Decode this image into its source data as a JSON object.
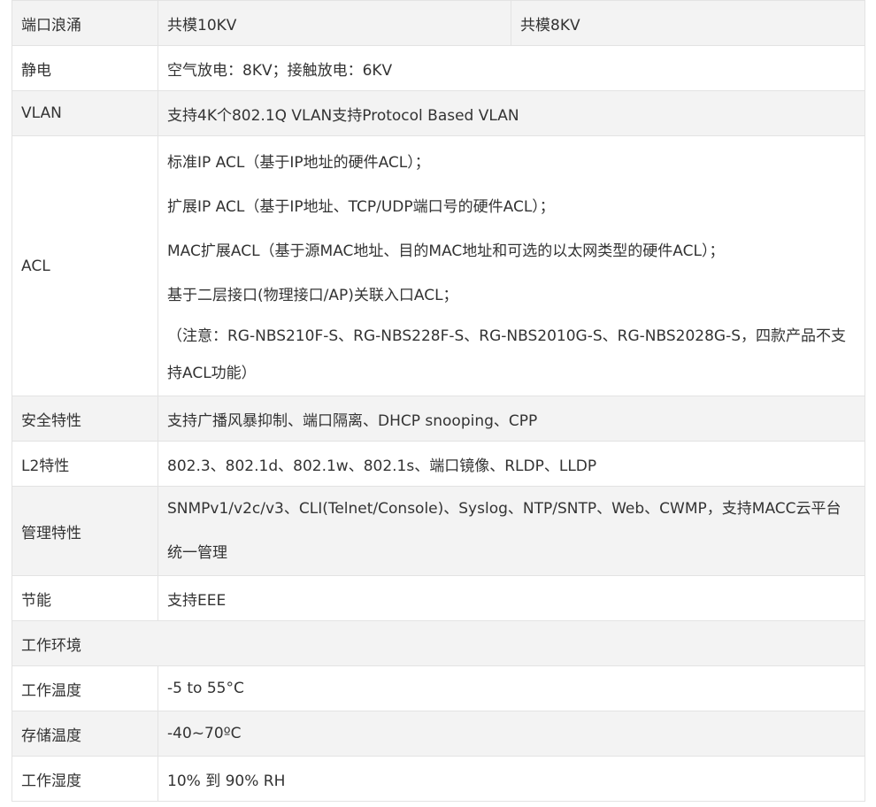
{
  "rows": [
    {
      "label": "端口浪涌",
      "value": "共模10KV",
      "value2": "共模8KV"
    },
    {
      "label": "静电",
      "value": "空气放电：8KV；接触放电：6KV"
    },
    {
      "label": "VLAN",
      "value": "支持4K个802.1Q VLAN支持Protocol Based VLAN"
    },
    {
      "label": "ACL",
      "lines": [
        "标准IP ACL（基于IP地址的硬件ACL）；",
        "扩展IP ACL（基于IP地址、TCP/UDP端口号的硬件ACL）；",
        "MAC扩展ACL（基于源MAC地址、目的MAC地址和可选的以太网类型的硬件ACL）；",
        "基于二层接口(物理接口/AP)关联入口ACL；",
        "（注意：RG-NBS210F-S、RG-NBS228F-S、RG-NBS2010G-S、RG-NBS2028G-S，四款产品不支持ACL功能）"
      ]
    },
    {
      "label": "安全特性",
      "value": "支持广播风暴抑制、端口隔离、DHCP snooping、CPP"
    },
    {
      "label": "L2特性",
      "value": "802.3、802.1d、802.1w、802.1s、端口镜像、RLDP、LLDP"
    },
    {
      "label": "管理特性",
      "value": "SNMPv1/v2c/v3、CLI(Telnet/Console)、Syslog、NTP/SNTP、Web、CWMP，支持MACC云平台统一管理"
    },
    {
      "label": "节能",
      "value": "支持EEE"
    },
    {
      "label": "工作环境"
    },
    {
      "label": "工作温度",
      "value": "-5 to 55°C"
    },
    {
      "label": "存储温度",
      "value": "-40~70ºC"
    },
    {
      "label": "工作湿度",
      "value": "10% 到 90% RH"
    }
  ]
}
